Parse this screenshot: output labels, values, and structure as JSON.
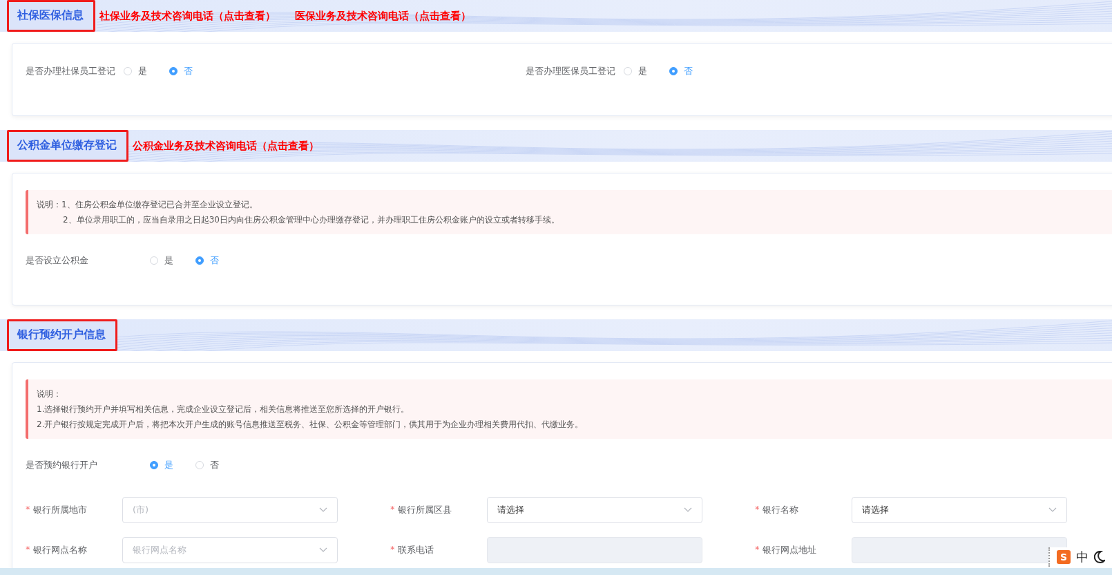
{
  "sections": [
    {
      "title": "社保医保信息",
      "links": [
        "社保业务及技术咨询电话（点击查看）",
        "医保业务及技术咨询电话（点击查看）"
      ],
      "questions": [
        {
          "label": "是否办理社保员工登记",
          "options": [
            {
              "label": "是",
              "selected": false
            },
            {
              "label": "否",
              "selected": true
            }
          ]
        },
        {
          "label": "是否办理医保员工登记",
          "options": [
            {
              "label": "是",
              "selected": false
            },
            {
              "label": "否",
              "selected": true
            }
          ]
        }
      ]
    },
    {
      "title": "公积金单位缴存登记",
      "links": [
        "公积金业务及技术咨询电话（点击查看）"
      ],
      "notice": [
        {
          "text": "说明：1、住房公积金单位缴存登记已合并至企业设立登记。",
          "indent": false
        },
        {
          "text": "2、单位录用职工的，应当自录用之日起30日内向住房公积金管理中心办理缴存登记，并办理职工住房公积金账户的设立或者转移手续。",
          "indent": true
        }
      ],
      "questions": [
        {
          "label": "是否设立公积金",
          "options": [
            {
              "label": "是",
              "selected": false
            },
            {
              "label": "否",
              "selected": true
            }
          ]
        }
      ]
    },
    {
      "title": "银行预约开户信息",
      "notice": [
        {
          "text": "说明：",
          "indent": false
        },
        {
          "text": "1.选择银行预约开户并填写相关信息，完成企业设立登记后，相关信息将推送至您所选择的开户银行。",
          "indent": false
        },
        {
          "text": "2.开户银行按规定完成开户后，将把本次开户生成的账号信息推送至税务、社保、公积金等管理部门，供其用于为企业办理相关费用代扣、代缴业务。",
          "indent": false
        }
      ],
      "questions": [
        {
          "label": "是否预约银行开户",
          "options": [
            {
              "label": "是",
              "selected": true
            },
            {
              "label": "否",
              "selected": false
            }
          ]
        }
      ],
      "fields": [
        {
          "asterisk": "*",
          "label": "银行所属地市",
          "kind": "select",
          "placeholder": "(市)"
        },
        {
          "asterisk": "*",
          "label": "银行所属区县",
          "kind": "select",
          "value": "请选择"
        },
        {
          "asterisk": "*",
          "label": "银行名称",
          "kind": "select",
          "value": "请选择"
        },
        {
          "asterisk": "*",
          "label": "银行网点名称",
          "kind": "select",
          "placeholder": "银行网点名称"
        },
        {
          "asterisk": "*",
          "label": "联系电话",
          "kind": "input",
          "disabled": true
        },
        {
          "asterisk": "*",
          "label": "银行网点地址",
          "kind": "input",
          "disabled": true
        }
      ]
    }
  ],
  "ime_toolbar": {
    "logo": "S",
    "mode": "中"
  }
}
